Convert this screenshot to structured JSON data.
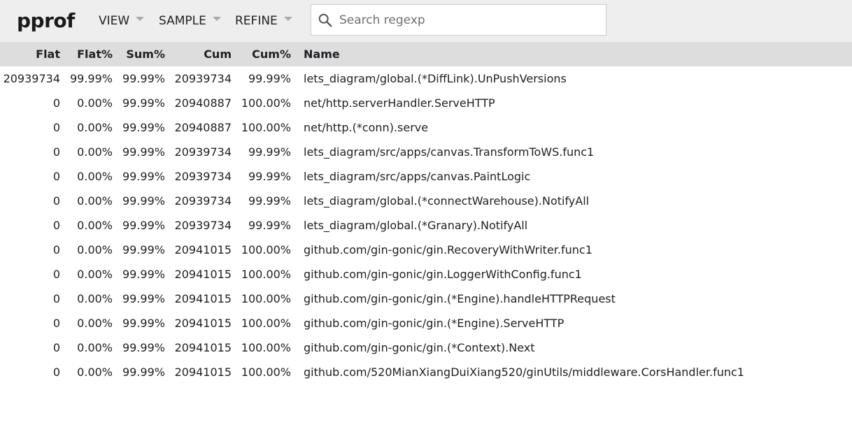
{
  "app": {
    "logo": "pprof"
  },
  "menus": [
    {
      "label": "VIEW"
    },
    {
      "label": "SAMPLE"
    },
    {
      "label": "REFINE"
    }
  ],
  "search": {
    "value": "",
    "placeholder": "Search regexp",
    "icon": "search-icon"
  },
  "table": {
    "columns": [
      "Flat",
      "Flat%",
      "Sum%",
      "Cum",
      "Cum%",
      "Name"
    ],
    "rows": [
      [
        "20939734",
        "99.99%",
        "99.99%",
        "20939734",
        "99.99%",
        "lets_diagram/global.(*DiffLink).UnPushVersions"
      ],
      [
        "0",
        "0.00%",
        "99.99%",
        "20940887",
        "100.00%",
        "net/http.serverHandler.ServeHTTP"
      ],
      [
        "0",
        "0.00%",
        "99.99%",
        "20940887",
        "100.00%",
        "net/http.(*conn).serve"
      ],
      [
        "0",
        "0.00%",
        "99.99%",
        "20939734",
        "99.99%",
        "lets_diagram/src/apps/canvas.TransformToWS.func1"
      ],
      [
        "0",
        "0.00%",
        "99.99%",
        "20939734",
        "99.99%",
        "lets_diagram/src/apps/canvas.PaintLogic"
      ],
      [
        "0",
        "0.00%",
        "99.99%",
        "20939734",
        "99.99%",
        "lets_diagram/global.(*connectWarehouse).NotifyAll"
      ],
      [
        "0",
        "0.00%",
        "99.99%",
        "20939734",
        "99.99%",
        "lets_diagram/global.(*Granary).NotifyAll"
      ],
      [
        "0",
        "0.00%",
        "99.99%",
        "20941015",
        "100.00%",
        "github.com/gin-gonic/gin.RecoveryWithWriter.func1"
      ],
      [
        "0",
        "0.00%",
        "99.99%",
        "20941015",
        "100.00%",
        "github.com/gin-gonic/gin.LoggerWithConfig.func1"
      ],
      [
        "0",
        "0.00%",
        "99.99%",
        "20941015",
        "100.00%",
        "github.com/gin-gonic/gin.(*Engine).handleHTTPRequest"
      ],
      [
        "0",
        "0.00%",
        "99.99%",
        "20941015",
        "100.00%",
        "github.com/gin-gonic/gin.(*Engine).ServeHTTP"
      ],
      [
        "0",
        "0.00%",
        "99.99%",
        "20941015",
        "100.00%",
        "github.com/gin-gonic/gin.(*Context).Next"
      ],
      [
        "0",
        "0.00%",
        "99.99%",
        "20941015",
        "100.00%",
        "github.com/520MianXiangDuiXiang520/ginUtils/middleware.CorsHandler.func1"
      ]
    ]
  },
  "colors": {
    "header_bg": "#eeeeee",
    "table_header_bg": "#dddddd",
    "caret": "#aaaaaa"
  }
}
